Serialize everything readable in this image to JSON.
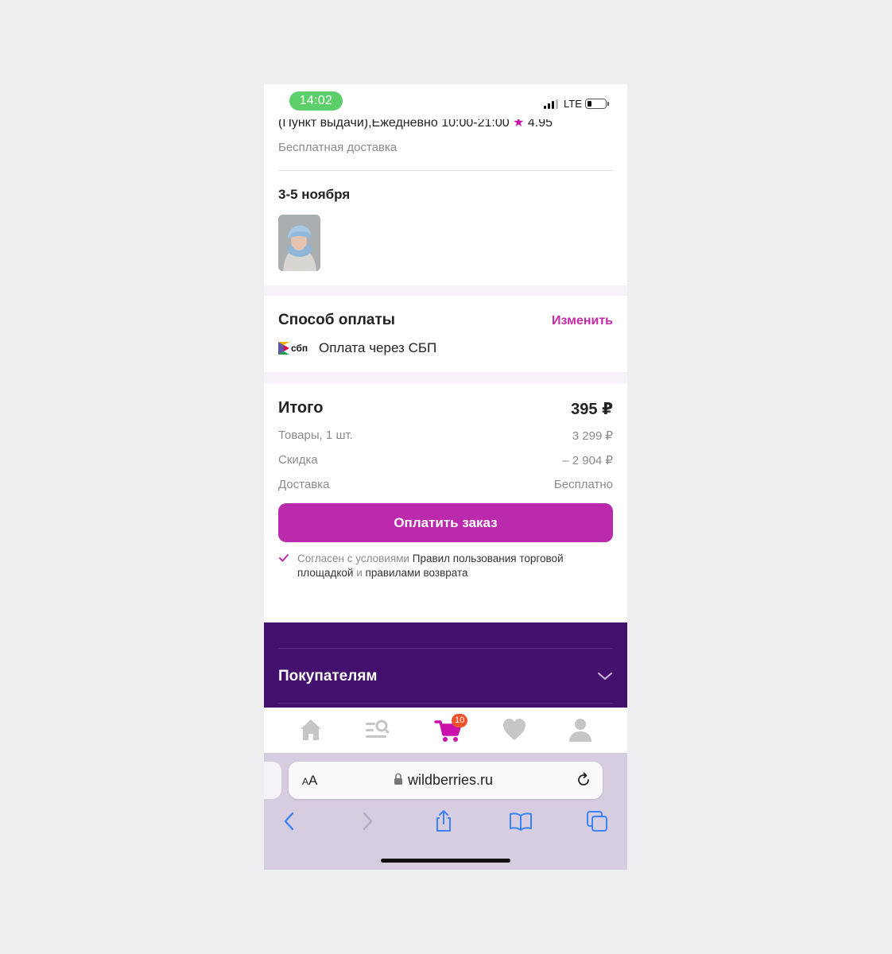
{
  "status_bar": {
    "time": "14:02",
    "network": "LTE"
  },
  "delivery": {
    "pickup_info": "(Пункт выдачи),Ежедневно 10:00-21:00",
    "rating_star": "★",
    "rating": "4.95",
    "free_delivery": "Бесплатная доставка",
    "date": "3-5 ноября"
  },
  "payment": {
    "title": "Способ оплаты",
    "change_label": "Изменить",
    "method": "Оплата через СБП",
    "logo_text": "сбп"
  },
  "summary": {
    "title": "Итого",
    "total": "395 ₽",
    "rows": [
      {
        "label": "Товары, 1 шт.",
        "value": "3 299 ₽"
      },
      {
        "label": "Скидка",
        "value": "– 2 904 ₽"
      },
      {
        "label": "Доставка",
        "value": "Бесплатно"
      }
    ],
    "pay_button": "Оплатить заказ",
    "agree_prefix": "Согласен с условиями",
    "agree_rules": "Правил пользования торговой площадкой",
    "agree_and": "и",
    "agree_returns": "правилами возврата"
  },
  "footer": {
    "buyers": "Покупателям"
  },
  "tabbar": {
    "cart_count": "10"
  },
  "browser": {
    "text_size_small": "A",
    "text_size_large": "A",
    "url": "wildberries.ru"
  },
  "colors": {
    "accent": "#bb2aad",
    "link": "#c12aa9",
    "footer_bg": "#44106d",
    "badge": "#f0532a",
    "browser_icons": "#3a82f7"
  }
}
